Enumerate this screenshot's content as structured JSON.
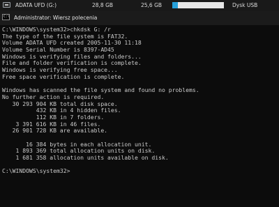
{
  "explorer_row": {
    "drive_name": "ADATA UFD (G:)",
    "total_size": "28,8 GB",
    "free_space": "25,6 GB",
    "used_fraction": 0.11,
    "drive_type": "Dysk USB",
    "icon": "usb-drive-icon"
  },
  "window": {
    "title": "Administrator: Wiersz polecenia",
    "icon": "command-prompt-icon",
    "icon_glyph": "C:\\"
  },
  "console": {
    "lines": [
      "C:\\WINDOWS\\system32>chkdsk G: /r",
      "The type of the file system is FAT32.",
      "Volume ADATA UFD created 2005-11-30 11:18",
      "Volume Serial Number is 8397-AD45",
      "Windows is verifying files and folders...",
      "File and folder verification is complete.",
      "Windows is verifying free space...",
      "Free space verification is complete.",
      "",
      "Windows has scanned the file system and found no problems.",
      "No further action is required.",
      "   30 293 904 KB total disk space.",
      "          432 KB in 4 hidden files.",
      "          112 KB in 7 folders.",
      "    3 391 616 KB in 46 files.",
      "   26 901 728 KB are available.",
      "",
      "       16 384 bytes in each allocation unit.",
      "    1 893 369 total allocation units on disk.",
      "    1 681 358 allocation units available on disk.",
      "",
      "C:\\WINDOWS\\system32>"
    ]
  },
  "colors": {
    "console_background": "#0c0c0c",
    "console_text": "#cccccc",
    "usage_fill": "#26a0da"
  }
}
